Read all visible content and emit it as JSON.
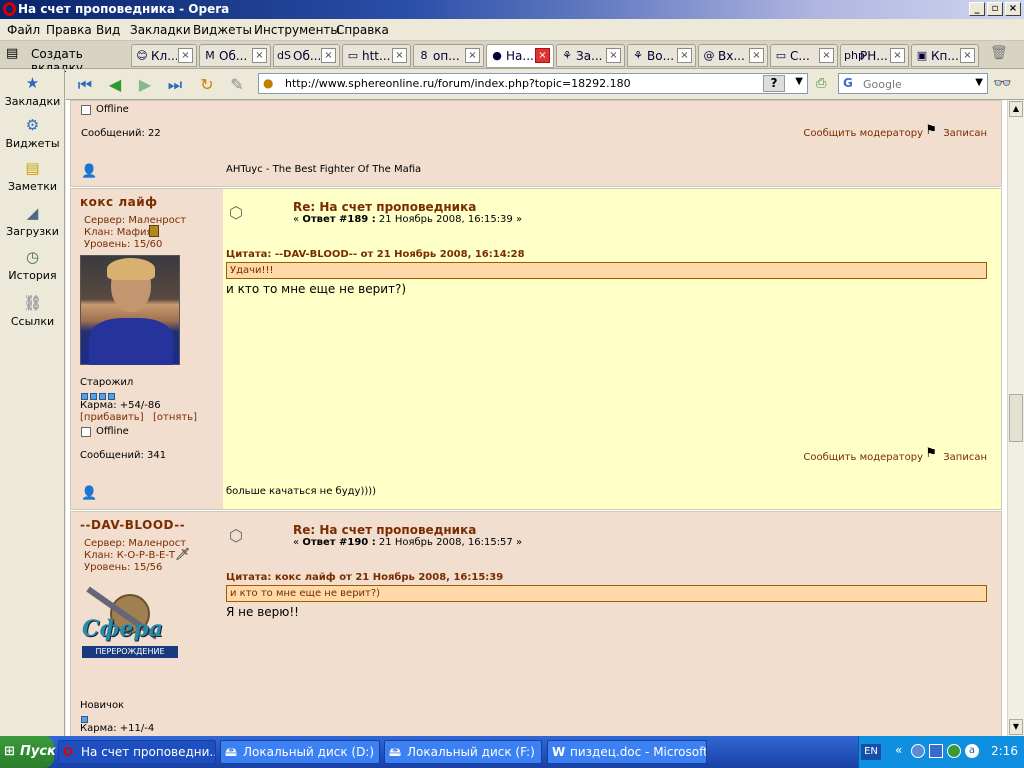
{
  "window": {
    "title": "На счет проповедника - Opera"
  },
  "menu": [
    "Файл",
    "Правка",
    "Вид",
    "Закладки",
    "Виджеты",
    "Инструменты",
    "Справка"
  ],
  "new_tab": "Создать вкладку",
  "tabs": [
    {
      "icon": "😊",
      "label": "Кл..."
    },
    {
      "icon": "M",
      "label": "Об..."
    },
    {
      "icon": "dS",
      "label": "Об..."
    },
    {
      "icon": "▭",
      "label": "htt..."
    },
    {
      "icon": "8",
      "label": "оп..."
    },
    {
      "icon": "●",
      "label": "На..."
    },
    {
      "icon": "⚘",
      "label": "За..."
    },
    {
      "icon": "⚘",
      "label": "Во..."
    },
    {
      "icon": "@",
      "label": "Вх..."
    },
    {
      "icon": "▭",
      "label": "С..."
    },
    {
      "icon": "php",
      "label": "РН..."
    },
    {
      "icon": "▣",
      "label": "Кп..."
    }
  ],
  "sidebar": [
    {
      "icon": "bookmarks-icon",
      "label": "Закладки"
    },
    {
      "icon": "widgets-icon",
      "label": "Виджеты"
    },
    {
      "icon": "notes-icon",
      "label": "Заметки"
    },
    {
      "icon": "downloads-icon",
      "label": "Загрузки"
    },
    {
      "icon": "history-icon",
      "label": "История"
    },
    {
      "icon": "links-icon",
      "label": "Ссылки"
    }
  ],
  "address": {
    "url": "http://www.sphereonline.ru/forum/index.php?topic=18292.180",
    "search_placeholder": "Google"
  },
  "top_partial": {
    "offline": "Offline",
    "messages": "Сообщений: 22",
    "report": "Сообщить модератору",
    "logged": "Записан",
    "signature": "AHTuyc - The Best Fighter Of The Mafia"
  },
  "posts": [
    {
      "author": "кокс лайф",
      "server": "Сервер: Маленрост",
      "clan": "Клан: Мафия",
      "level": "Уровень: 15/60",
      "rank": "Старожил",
      "karma": "Карма: +54/-86",
      "karma_add": "[прибавить]",
      "karma_take": "[отнять]",
      "status": "Offline",
      "messages": "Сообщений: 341",
      "title": "Re: На счет проповедника",
      "meta_prefix": "«",
      "reply": "Ответ #189 :",
      "date": "21 Ноябрь 2008, 16:15:39",
      "meta_suffix": "»",
      "quote_head": "Цитата: --DAV-BLOOD-- от 21 Ноябрь 2008, 16:14:28",
      "quote": "Удачи!!!",
      "text": "и кто то мне еще не верит?)",
      "report": "Сообщить модератору",
      "logged": "Записан",
      "signature": "больше качаться не буду))))"
    },
    {
      "author": "--DAV-BLOOD--",
      "server": "Сервер: Маленрост",
      "clan": "Клан: К-О-Р-В-Е-Т",
      "level": "Уровень: 15/56",
      "rank": "Новичок",
      "karma": "Карма: +11/-4",
      "title": "Re: На счет проповедника",
      "meta_prefix": "«",
      "reply": "Ответ #190 :",
      "date": "21 Ноябрь 2008, 16:15:57",
      "meta_suffix": "»",
      "quote_head": "Цитата: кокс лайф от 21 Ноябрь 2008, 16:15:39",
      "quote": "и кто то мне еще не верит?)",
      "text": "Я не верю!!",
      "logo_text": "Сфера",
      "logo_sub": "ПЕРЕРОЖДЕНИЕ"
    }
  ],
  "taskbar": {
    "start": "Пуск",
    "items": [
      "На счет проповедни...",
      "Локальный диск (D:)",
      "Локальный диск (F:)",
      "пиздец.doc - Microsoft ..."
    ],
    "lang": "EN",
    "time": "2:16"
  }
}
